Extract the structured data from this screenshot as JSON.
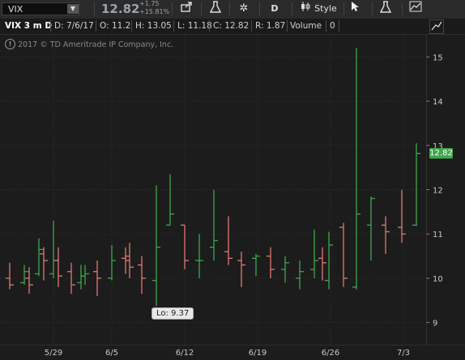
{
  "toolbar": {
    "symbol": "VIX",
    "last_price": "12.82",
    "change_abs": "+1.75",
    "change_pct": "+15.81%",
    "share_icon": "share-icon",
    "studies_icon": "flask-icon",
    "settings_icon": "gear-icon",
    "aggregation": "D",
    "style_label": "Style",
    "drawing_icon": "cursor-arrow-icon",
    "lab_icon": "flask-icon",
    "drawings_icon": "drawings-icon"
  },
  "infobar": {
    "title": "VIX 3 m D",
    "date": "D: 7/6/17",
    "open": "O: 11.2",
    "high": "H: 13.05",
    "low": "L: 11.18",
    "close": "C: 12.82",
    "range": "R: 1.87",
    "volume_label": "Volume",
    "volume_value": "0"
  },
  "copyright": "2017 © TD Ameritrade IP Company, Inc.",
  "lo_label": "Lo: 9.37",
  "price_flag": "12.82",
  "colors": {
    "up": "#3fa84b",
    "down": "#e07a72",
    "background": "#1c1c1c",
    "grid": "#2f2f2f",
    "flag": "#3fa84b"
  },
  "chart_data": {
    "type": "ohlc",
    "ylim": [
      8.5,
      15.5
    ],
    "yticks": [
      9,
      10,
      11,
      12,
      13,
      14,
      15
    ],
    "xtick_labels": [
      {
        "label": "5/29",
        "index": 2
      },
      {
        "label": "6/5",
        "index": 6
      },
      {
        "label": "6/12",
        "index": 11
      },
      {
        "label": "6/19",
        "index": 16
      },
      {
        "label": "6/26",
        "index": 21
      },
      {
        "label": "7/3",
        "index": 26
      }
    ],
    "bars": [
      {
        "o": 10.0,
        "h": 10.35,
        "l": 9.75,
        "c": 9.85
      },
      {
        "o": 9.9,
        "h": 10.3,
        "l": 9.85,
        "c": 10.15
      },
      {
        "o": 10.0,
        "h": 10.25,
        "l": 9.65,
        "c": 9.85
      },
      {
        "o": 10.1,
        "h": 10.9,
        "l": 10.05,
        "c": 10.65
      },
      {
        "o": 10.55,
        "h": 10.7,
        "l": 9.95,
        "c": 10.4
      },
      {
        "o": 10.1,
        "h": 11.3,
        "l": 10.0,
        "c": 10.4
      },
      {
        "o": 10.4,
        "h": 10.7,
        "l": 9.8,
        "c": 10.05
      },
      {
        "o": 10.15,
        "h": 10.35,
        "l": 9.65,
        "c": 9.85
      },
      {
        "o": 9.9,
        "h": 10.3,
        "l": 9.75,
        "c": 10.05
      },
      {
        "o": 10.05,
        "h": 10.3,
        "l": 9.85,
        "c": 10.1
      },
      {
        "o": 10.15,
        "h": 10.4,
        "l": 9.6,
        "c": 10.0
      },
      {
        "o": 10.0,
        "h": 10.75,
        "l": 9.95,
        "c": 10.4
      },
      {
        "o": 10.45,
        "h": 10.7,
        "l": 10.1,
        "c": 10.4
      },
      {
        "o": 10.5,
        "h": 10.8,
        "l": 10.0,
        "c": 10.25
      },
      {
        "o": 10.3,
        "h": 10.5,
        "l": 9.65,
        "c": 10.0
      },
      {
        "o": 9.95,
        "h": 12.1,
        "l": 9.37,
        "c": 10.7
      },
      {
        "o": 11.2,
        "h": 12.35,
        "l": 11.2,
        "c": 11.45
      },
      {
        "o": 11.2,
        "h": 11.2,
        "l": 10.2,
        "c": 10.4
      },
      {
        "o": 10.4,
        "h": 11.0,
        "l": 10.0,
        "c": 10.4
      },
      {
        "o": 10.7,
        "h": 12.0,
        "l": 10.4,
        "c": 10.85
      },
      {
        "o": 10.6,
        "h": 11.4,
        "l": 10.3,
        "c": 10.45
      },
      {
        "o": 10.4,
        "h": 10.6,
        "l": 9.8,
        "c": 10.3
      },
      {
        "o": 10.45,
        "h": 10.55,
        "l": 10.05,
        "c": 10.5
      }
    ]
  }
}
